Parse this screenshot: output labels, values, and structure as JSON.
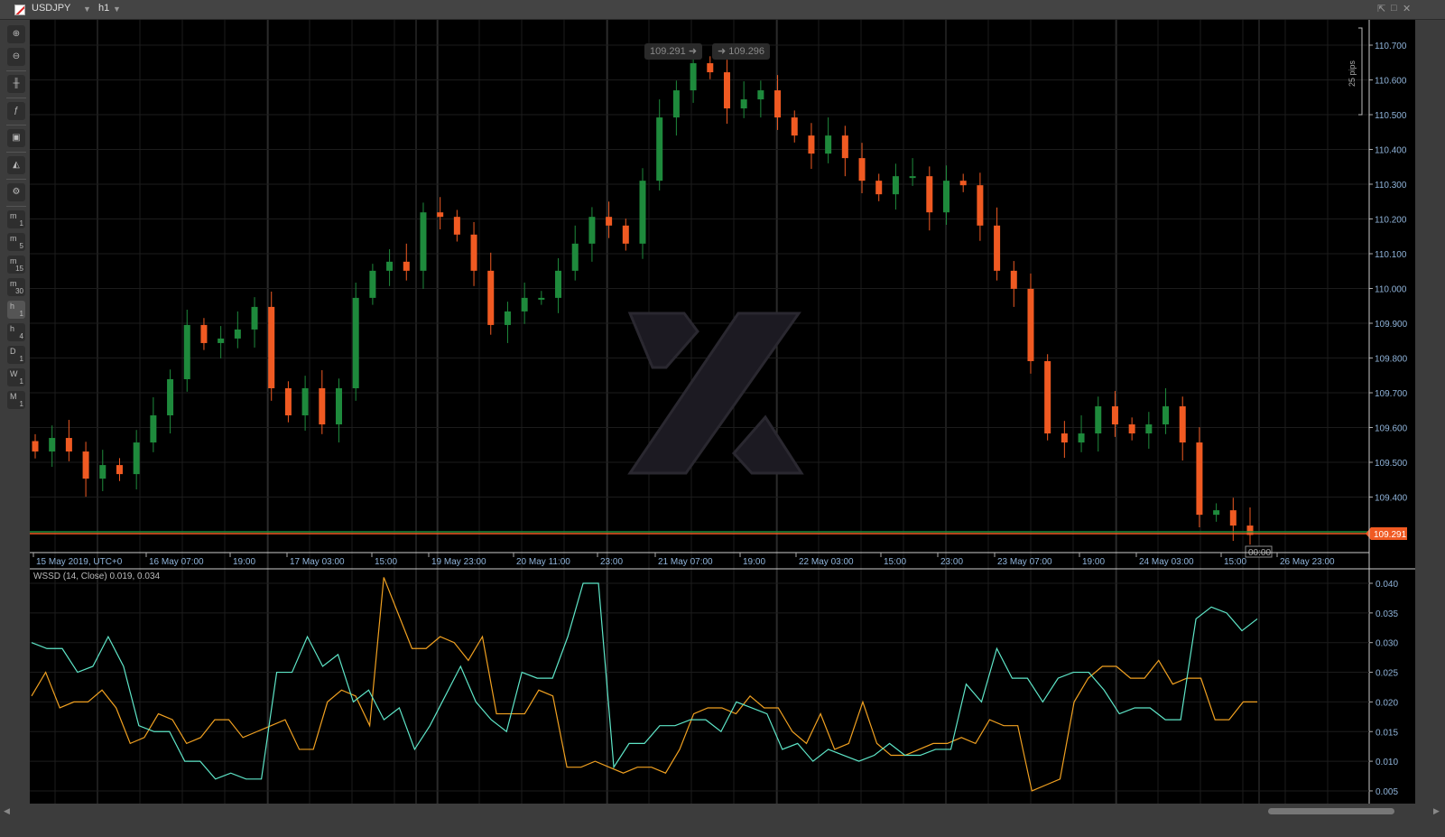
{
  "window": {
    "symbol": "USDJPY",
    "timeframe": "h1"
  },
  "toolbar": {
    "zoom_in": "zoom-in",
    "zoom_out": "zoom-out",
    "timeframes": [
      [
        "m",
        "1"
      ],
      [
        "m",
        "5"
      ],
      [
        "m",
        "15"
      ],
      [
        "m",
        "30"
      ],
      [
        "h",
        "1"
      ],
      [
        "h",
        "4"
      ],
      [
        "D",
        "1"
      ],
      [
        "W",
        "1"
      ],
      [
        "M",
        "1"
      ]
    ],
    "selected_timeframe": "h1"
  },
  "quote": {
    "sell": "109.291",
    "buy": "109.296"
  },
  "pips_label": "25 pips",
  "current_price": "109.291",
  "countdown": "00:00",
  "price_axis": [
    "110.700",
    "110.600",
    "110.500",
    "110.400",
    "110.300",
    "110.200",
    "110.100",
    "110.000",
    "109.900",
    "109.800",
    "109.700",
    "109.600",
    "109.500",
    "109.400"
  ],
  "time_axis": [
    "15 May 2019, UTC+0",
    "16 May 07:00",
    "19:00",
    "17 May 03:00",
    "15:00",
    "19 May 23:00",
    "20 May 11:00",
    "23:00",
    "21 May 07:00",
    "19:00",
    "22 May 03:00",
    "15:00",
    "23:00",
    "23 May 07:00",
    "19:00",
    "24 May 03:00",
    "15:00",
    "26 May 23:00"
  ],
  "indicator": {
    "label": "WSSD (14, Close) 0.019, 0.034",
    "axis": [
      "0.040",
      "0.035",
      "0.030",
      "0.025",
      "0.020",
      "0.015",
      "0.010",
      "0.005"
    ],
    "teal": [
      0.03,
      0.029,
      0.029,
      0.025,
      0.026,
      0.031,
      0.026,
      0.016,
      0.015,
      0.015,
      0.01,
      0.01,
      0.007,
      0.008,
      0.007,
      0.007,
      0.025,
      0.025,
      0.031,
      0.026,
      0.028,
      0.02,
      0.022,
      0.017,
      0.019,
      0.012,
      0.016,
      0.021,
      0.026,
      0.02,
      0.017,
      0.015,
      0.025,
      0.024,
      0.024,
      0.031,
      0.04,
      0.04,
      0.009,
      0.013,
      0.013,
      0.016,
      0.016,
      0.017,
      0.017,
      0.015,
      0.02,
      0.019,
      0.018,
      0.012,
      0.013,
      0.01,
      0.012,
      0.011,
      0.01,
      0.011,
      0.013,
      0.011,
      0.011,
      0.012,
      0.012,
      0.023,
      0.02,
      0.029,
      0.024,
      0.024,
      0.02,
      0.024,
      0.025,
      0.025,
      0.022,
      0.018,
      0.019,
      0.019,
      0.017,
      0.017,
      0.034,
      0.036,
      0.035,
      0.032,
      0.034
    ],
    "orange": [
      0.021,
      0.025,
      0.019,
      0.02,
      0.02,
      0.022,
      0.019,
      0.013,
      0.014,
      0.018,
      0.017,
      0.013,
      0.014,
      0.017,
      0.017,
      0.014,
      0.015,
      0.016,
      0.017,
      0.012,
      0.012,
      0.02,
      0.022,
      0.021,
      0.016,
      0.041,
      0.035,
      0.029,
      0.029,
      0.031,
      0.03,
      0.027,
      0.031,
      0.018,
      0.018,
      0.018,
      0.022,
      0.021,
      0.009,
      0.009,
      0.01,
      0.009,
      0.008,
      0.009,
      0.009,
      0.008,
      0.012,
      0.018,
      0.019,
      0.019,
      0.018,
      0.021,
      0.019,
      0.019,
      0.015,
      0.013,
      0.018,
      0.012,
      0.013,
      0.02,
      0.013,
      0.011,
      0.011,
      0.012,
      0.013,
      0.013,
      0.014,
      0.013,
      0.017,
      0.016,
      0.016,
      0.005,
      0.006,
      0.007,
      0.02,
      0.024,
      0.026,
      0.026,
      0.024,
      0.024,
      0.027,
      0.023,
      0.024,
      0.024,
      0.017,
      0.017,
      0.02,
      0.02
    ]
  },
  "candles_close": [
    109.531,
    109.57,
    109.531,
    109.453,
    109.492,
    109.466,
    109.557,
    109.635,
    109.739,
    109.895,
    109.843,
    109.856,
    109.882,
    109.947,
    109.713,
    109.635,
    109.713,
    109.609,
    109.713,
    109.973,
    110.051,
    110.077,
    110.051,
    110.219,
    110.206,
    110.155,
    110.051,
    109.895,
    109.934,
    109.973,
    109.973,
    110.051,
    110.129,
    110.206,
    110.181,
    110.129,
    110.31,
    110.492,
    110.57,
    110.648,
    110.622,
    110.518,
    110.544,
    110.57,
    110.492,
    110.44,
    110.388,
    110.44,
    110.375,
    110.31,
    110.271,
    110.323,
    110.323,
    110.219,
    110.31,
    110.297,
    110.181,
    110.051,
    109.999,
    109.791,
    109.583,
    109.557,
    109.583,
    109.661,
    109.609,
    109.583,
    109.609,
    109.661,
    109.557,
    109.349,
    109.362,
    109.318,
    109.291
  ],
  "colors": {
    "bull": "#1e8a3c",
    "bear": "#f05a22",
    "teal": "#5ee6c8",
    "orange": "#f0a020",
    "axis_text": "#8fb3d9"
  }
}
